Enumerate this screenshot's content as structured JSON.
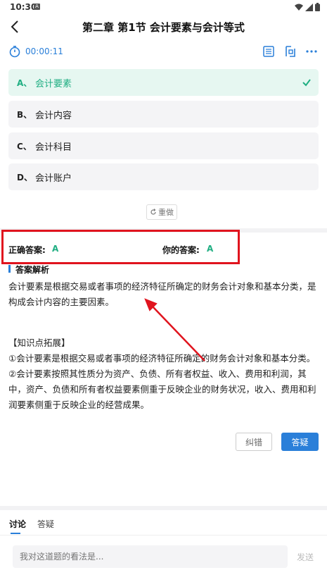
{
  "status_bar": {
    "time": "10:30",
    "app_badge": "A"
  },
  "header": {
    "title": "第二章  第1节  会计要素与会计等式"
  },
  "toolbar": {
    "timer": "00:00:11"
  },
  "options": [
    {
      "letter": "A、",
      "text": "会计要素",
      "selected": true
    },
    {
      "letter": "B、",
      "text": "会计内容",
      "selected": false
    },
    {
      "letter": "C、",
      "text": "会计科目",
      "selected": false
    },
    {
      "letter": "D、",
      "text": "会计账户",
      "selected": false
    }
  ],
  "redo_label": "重做",
  "answers": {
    "correct_label": "正确答案:",
    "correct_value": "A",
    "yours_label": "你的答案:",
    "yours_value": "A"
  },
  "analysis": {
    "title": "答案解析",
    "text": "会计要素是根据交易或者事项的经济特征所确定的财务会计对象和基本分类，是构成会计内容的主要因素。",
    "extension_title": "【知识点拓展】",
    "ext1": "①会计要素是根据交易或者事项的经济特征所确定的财务会计对象和基本分类。",
    "ext2": "②会计要素按照其性质分为资产、负债、所有者权益、收入、费用和利润，其中，资产、负债和所有者权益要素侧重于反映企业的财务状况，收入、费用和利润要素侧重于反映企业的经营成果。"
  },
  "actions": {
    "correct_error": "纠错",
    "ask_question": "答疑"
  },
  "bottom_tabs": [
    {
      "label": "讨论"
    },
    {
      "label": "答疑"
    }
  ],
  "comment": {
    "placeholder": "我对这道题的看法是...",
    "send": "发送"
  },
  "colors": {
    "accent": "#2a7fd9",
    "correct": "#1fae82",
    "highlight": "#e0141e"
  }
}
